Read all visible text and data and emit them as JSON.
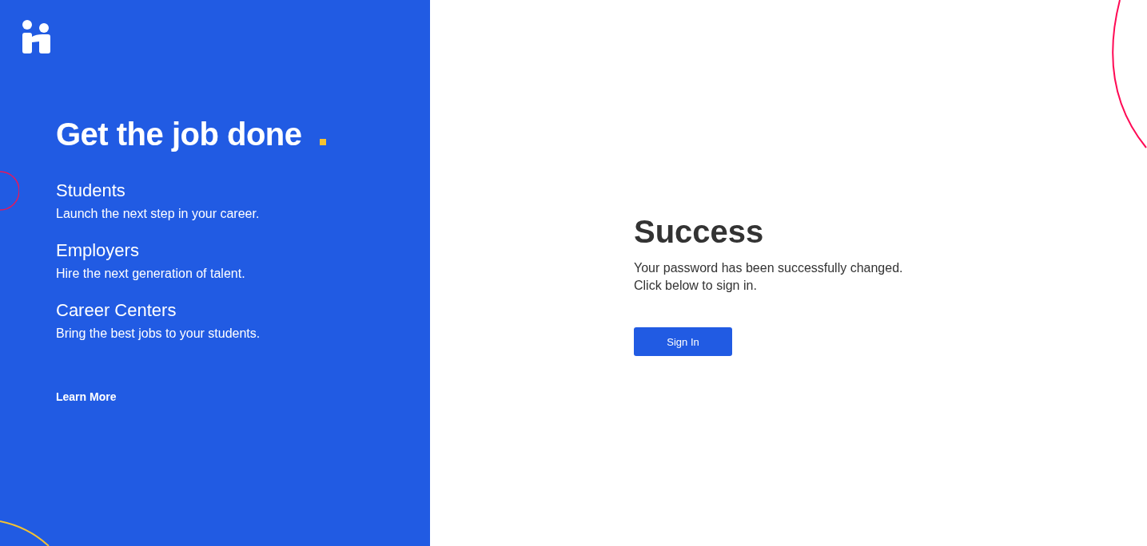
{
  "hero": {
    "headline": "Get the job done"
  },
  "audiences": [
    {
      "title": "Students",
      "description": "Launch the next step in your career."
    },
    {
      "title": "Employers",
      "description": "Hire the next generation of talent."
    },
    {
      "title": "Career Centers",
      "description": "Bring the best jobs to your students."
    }
  ],
  "learn_more": "Learn More",
  "success": {
    "title": "Success",
    "message_lines": [
      "Your password has been successfully changed.",
      "Click below to sign in."
    ],
    "button": "Sign In"
  }
}
